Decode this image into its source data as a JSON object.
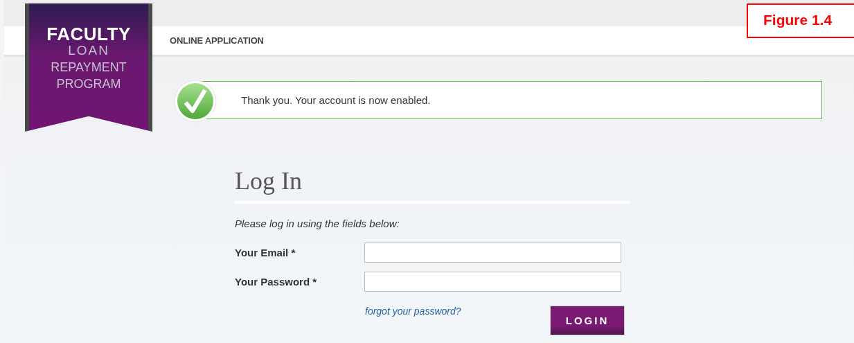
{
  "figure_label": "Figure 1.4",
  "logo": {
    "lines": [
      "FACULTY",
      "LOAN",
      "REPAYMENT",
      "PROGRAM"
    ]
  },
  "nav": {
    "title": "ONLINE APPLICATION"
  },
  "notice": {
    "kind": "success",
    "message": "Thank you. Your account is now enabled."
  },
  "login": {
    "heading": "Log In",
    "instructions": "Please log in using the fields below:",
    "fields": [
      {
        "label": "Your Email *"
      },
      {
        "label": "Your Password *"
      }
    ],
    "forgot_link": "forgot your password?",
    "button": "LOGIN"
  }
}
